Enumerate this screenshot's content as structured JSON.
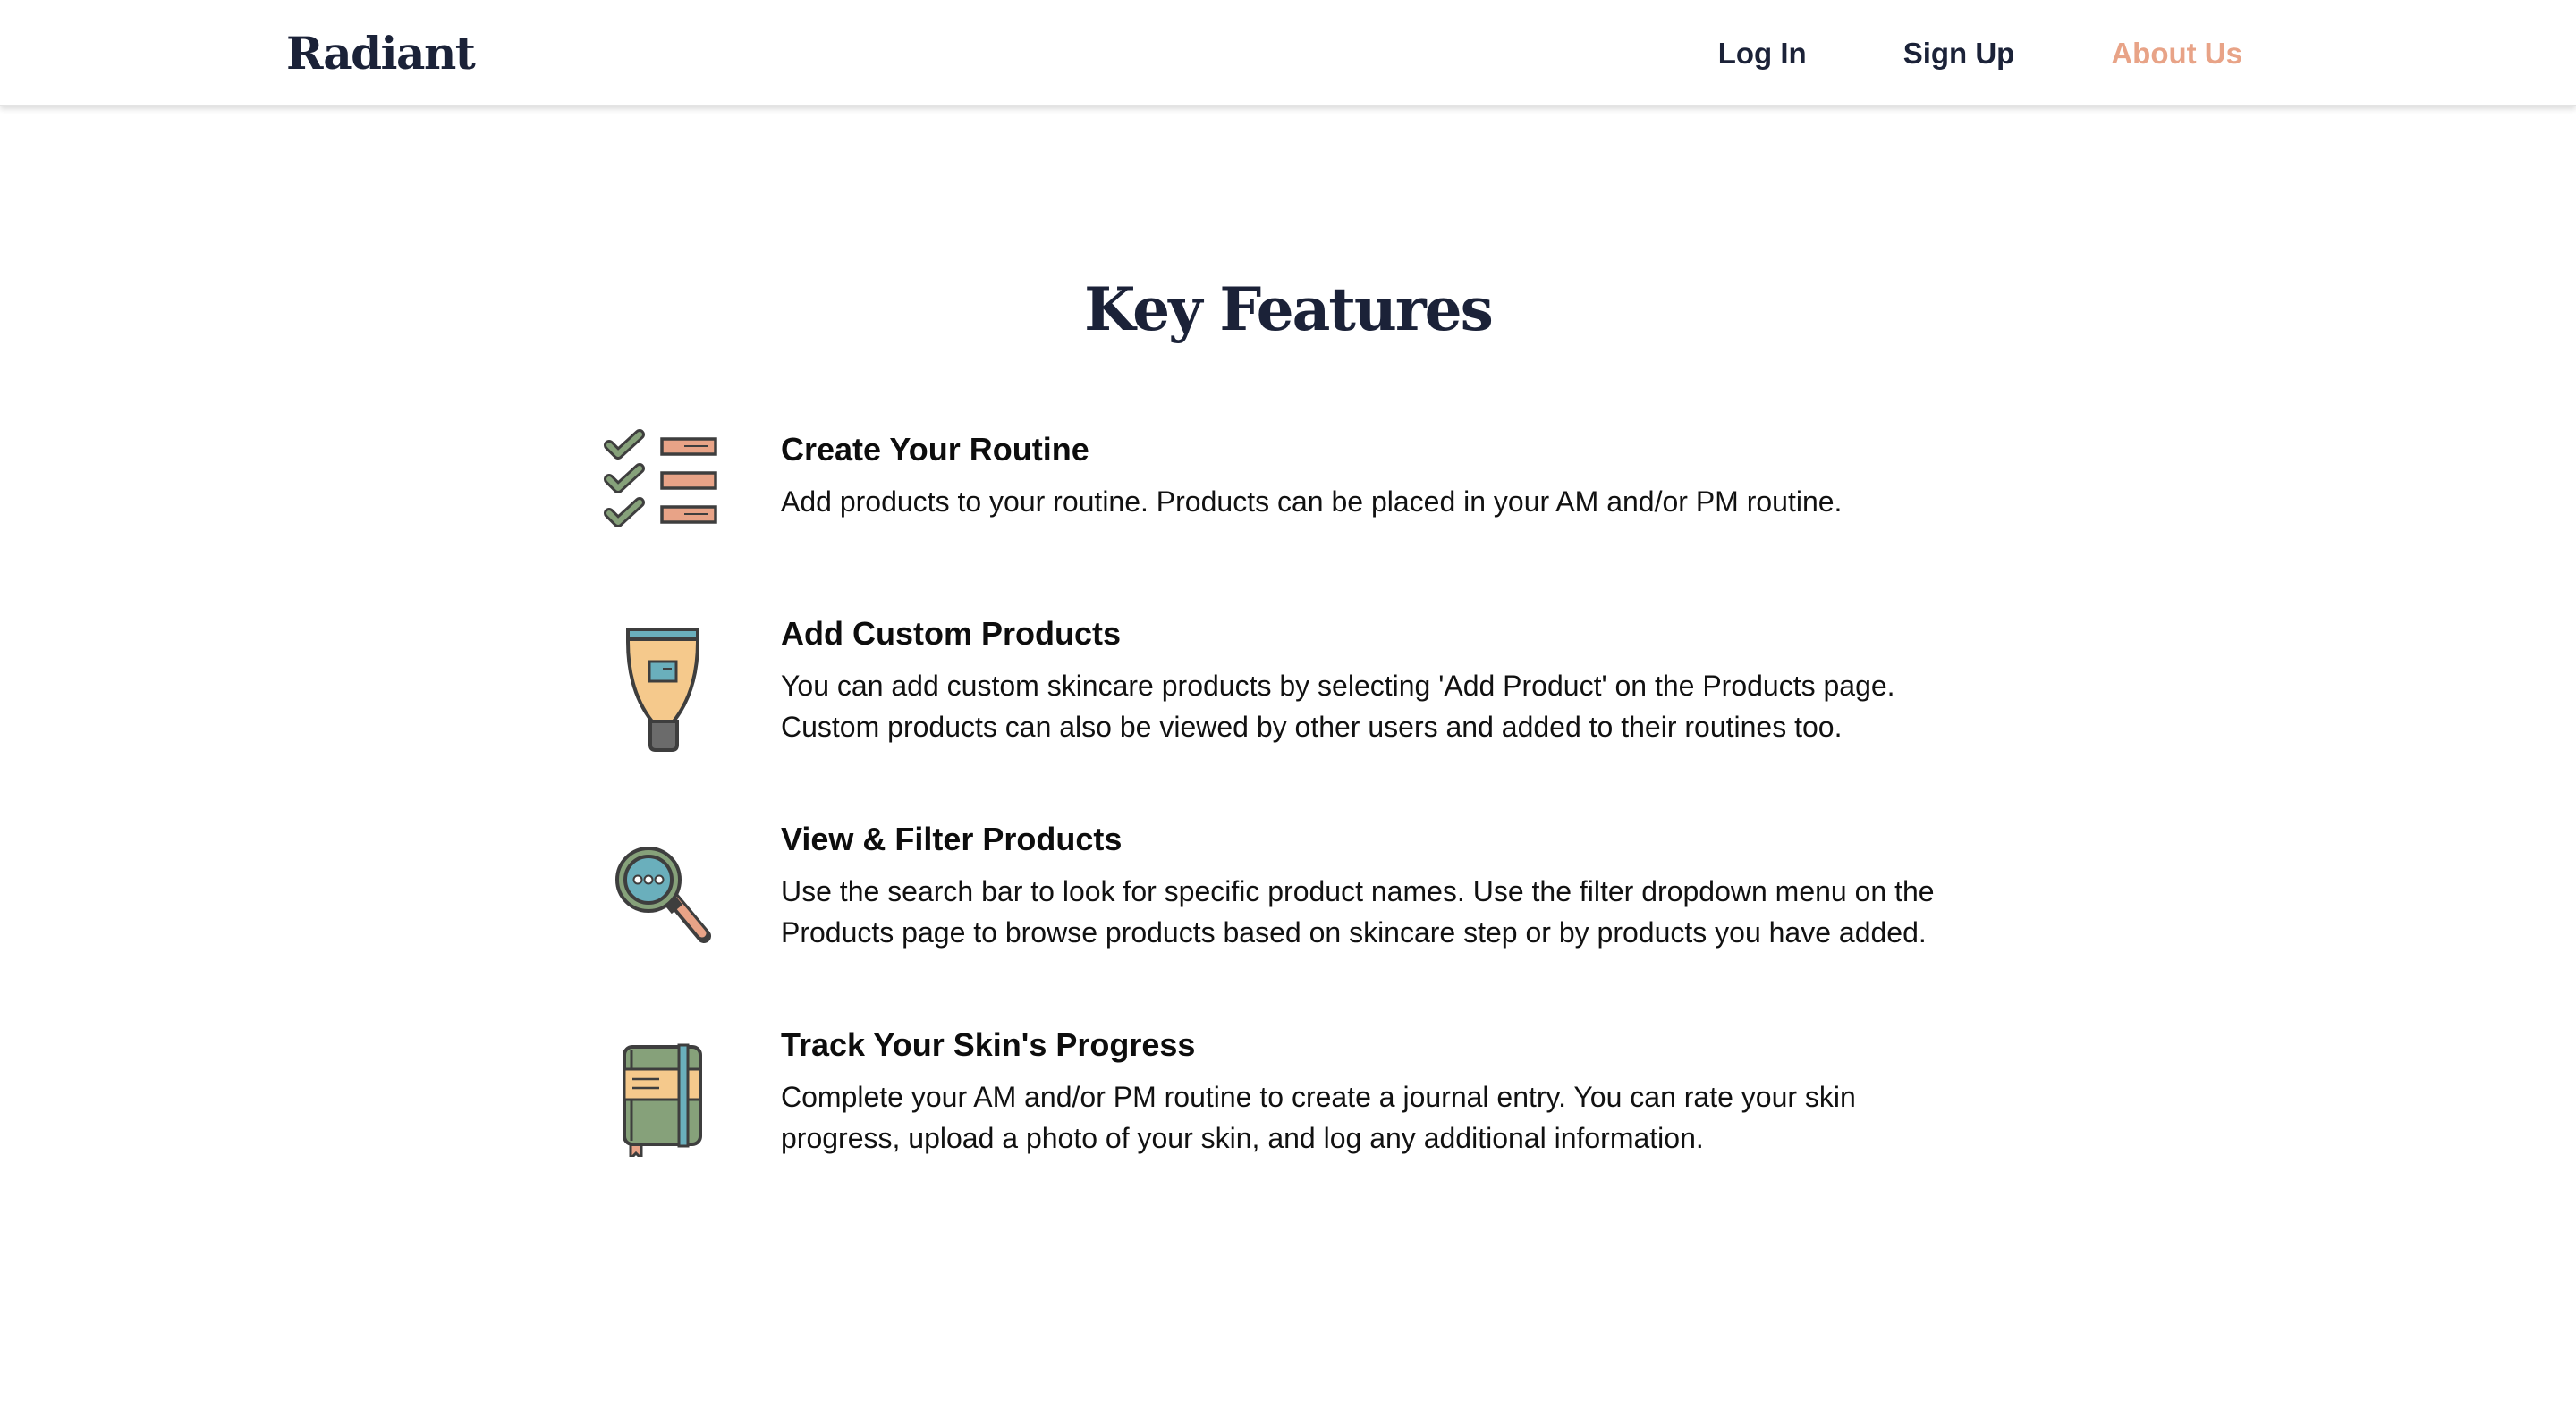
{
  "nav": {
    "brand": "Radiant",
    "links": [
      {
        "label": "Log In"
      },
      {
        "label": "Sign Up"
      },
      {
        "label": "About Us"
      }
    ],
    "active_color": "#e8a387"
  },
  "main": {
    "title": "Key Features",
    "features": [
      {
        "icon": "checklist-icon",
        "title": "Create Your Routine",
        "description": "Add products to your routine. Products can be placed in your AM and/or PM routine."
      },
      {
        "icon": "tube-icon",
        "title": "Add Custom Products",
        "description": "You can add custom skincare products by selecting 'Add Product' on the Products page.\nCustom products can also be viewed by other users and added to their routines too."
      },
      {
        "icon": "magnifier-icon",
        "title": "View & Filter Products",
        "description": "Use the search bar to look for specific product names. Use the filter dropdown menu on the\nProducts page to browse products based on skincare step or by products you have added."
      },
      {
        "icon": "journal-icon",
        "title": "Track Your Skin's Progress",
        "description": "Complete your AM and/or PM routine to create a journal entry. You can rate your skin\nprogress, upload a photo of your skin, and log any additional information."
      }
    ]
  },
  "colors": {
    "navy": "#1b2238",
    "peach": "#e8a387",
    "green": "#86a17a",
    "tan": "#f5c98c",
    "teal": "#6aafbc",
    "dark_outline": "#3e3e3e"
  }
}
